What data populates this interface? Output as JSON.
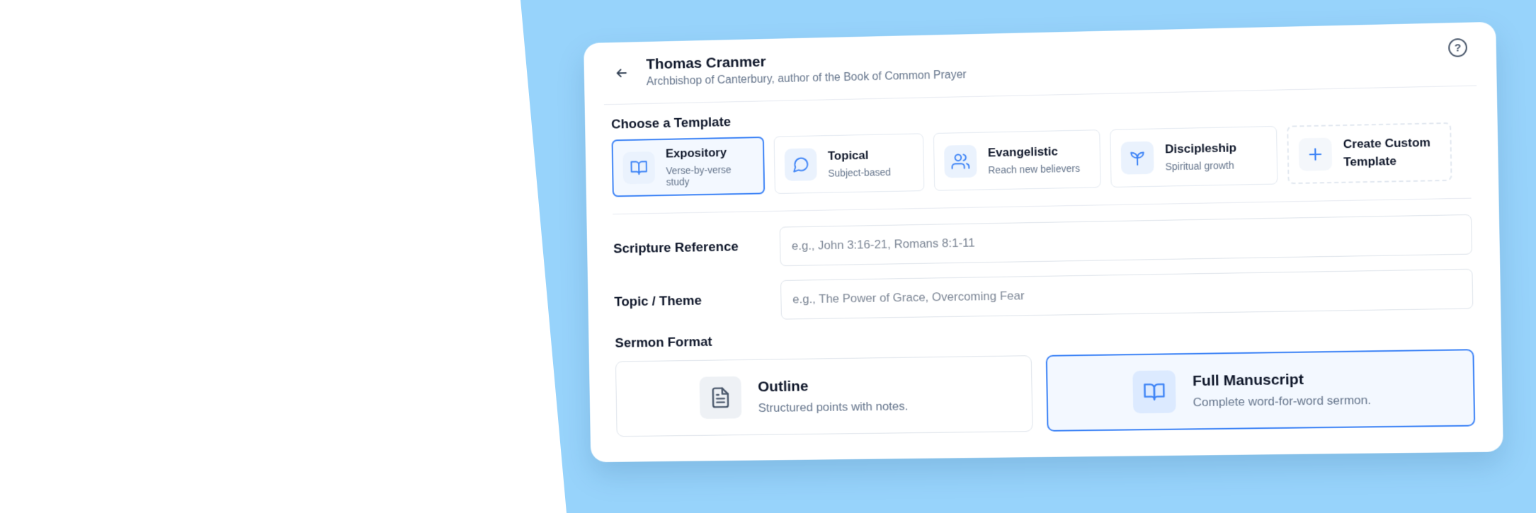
{
  "header": {
    "title": "Thomas Cranmer",
    "subtitle": "Archbishop of Canterbury, author of the Book of Common Prayer",
    "back_icon": "arrow-left-icon",
    "help_icon": "help-circle-icon"
  },
  "templates": {
    "label": "Choose a Template",
    "items": [
      {
        "name": "Expository",
        "desc": "Verse-by-verse study",
        "icon": "book-open-icon"
      },
      {
        "name": "Topical",
        "desc": "Subject-based",
        "icon": "message-circle-icon"
      },
      {
        "name": "Evangelistic",
        "desc": "Reach new believers",
        "icon": "users-icon"
      },
      {
        "name": "Discipleship",
        "desc": "Spiritual growth",
        "icon": "sprout-icon"
      },
      {
        "name": "Create Custom Template",
        "icon": "plus-icon"
      }
    ]
  },
  "fields": {
    "scripture": {
      "label": "Scripture Reference",
      "placeholder": "e.g., John 3:16-21, Romans 8:1-11"
    },
    "topic": {
      "label": "Topic / Theme",
      "placeholder": "e.g., The Power of Grace, Overcoming Fear"
    }
  },
  "format": {
    "label": "Sermon Format",
    "options": [
      {
        "name": "Outline",
        "desc": "Structured points with notes.",
        "icon": "file-text-icon"
      },
      {
        "name": "Full Manuscript",
        "desc": "Complete word-for-word sermon.",
        "icon": "book-open-icon"
      }
    ]
  },
  "colors": {
    "accent": "#3b82f6",
    "background_panel": "#97d3fb",
    "selected_fill": "#f3f8ff"
  }
}
